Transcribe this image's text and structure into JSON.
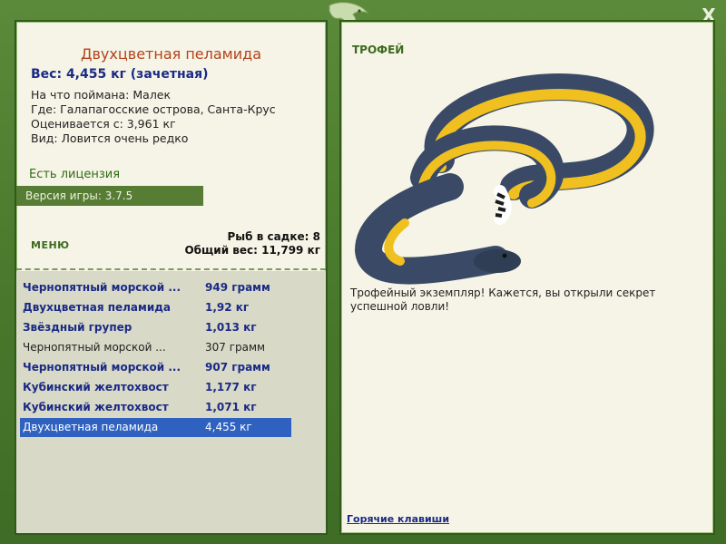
{
  "window": {
    "close_label": "X",
    "logo_icon": "fish-logo-icon"
  },
  "fish": {
    "title": "Двухцветная пеламида",
    "weight": "Вес: 4,455 кг (зачетная)",
    "bait": "На что поймана: Малек",
    "location": "Где: Галапагосские острова, Санта-Крус",
    "rated_from": "Оценивается с: 3,961 кг",
    "rarity": "Вид: Ловится очень редко"
  },
  "license": "Есть лицензия",
  "version": "Версия игры: 3.7.5",
  "menu_label": "МЕНЮ",
  "stats": {
    "fish_count": "Рыб в садке: 8",
    "total_weight": "Общий вес: 11,799 кг"
  },
  "catch_list": [
    {
      "name": "Чернопятный морской ...",
      "weight": "949 грамм",
      "style": "bold"
    },
    {
      "name": "Двухцветная пеламида",
      "weight": "1,92 кг",
      "style": "bold"
    },
    {
      "name": "Звёздный групер",
      "weight": "1,013 кг",
      "style": "bold"
    },
    {
      "name": "Чернопятный морской ...",
      "weight": "307 грамм",
      "style": "plain"
    },
    {
      "name": "Чернопятный морской ...",
      "weight": "907 грамм",
      "style": "bold"
    },
    {
      "name": "Кубинский желтохвост",
      "weight": "1,177 кг",
      "style": "bold"
    },
    {
      "name": "Кубинский желтохвост",
      "weight": "1,071 кг",
      "style": "bold"
    },
    {
      "name": "Двухцветная пеламида",
      "weight": "4,455 кг",
      "style": "sel"
    }
  ],
  "trophy": {
    "label": "ТРОФЕЙ",
    "image_icon": "sea-snake-image",
    "text": "Трофейный экземпляр! Кажется, вы открыли секрет успешной ловли!"
  },
  "hotkeys_link": "Горячие клавиши",
  "colors": {
    "frame_green": "#4d7a31",
    "panel_bg": "#f6f4e6",
    "title_orange": "#b5421a",
    "text_blue": "#1a2a86",
    "selection_blue": "#2f62c0",
    "snake_yellow": "#f0c020",
    "snake_navy": "#3a4a66"
  }
}
